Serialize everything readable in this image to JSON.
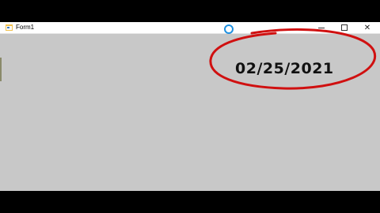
{
  "window": {
    "title": "Form1"
  },
  "controls": {
    "minimize_glyph": "",
    "maximize_glyph": "",
    "close_glyph": "✕"
  },
  "form": {
    "date_text": "02/25/2021"
  },
  "colors": {
    "client_bg": "#c8c8c8",
    "highlight": "#d01010",
    "loading_ring": "#1e90e0"
  },
  "icons": {
    "app": "form-app-icon",
    "loading": "loading-ring-icon"
  }
}
